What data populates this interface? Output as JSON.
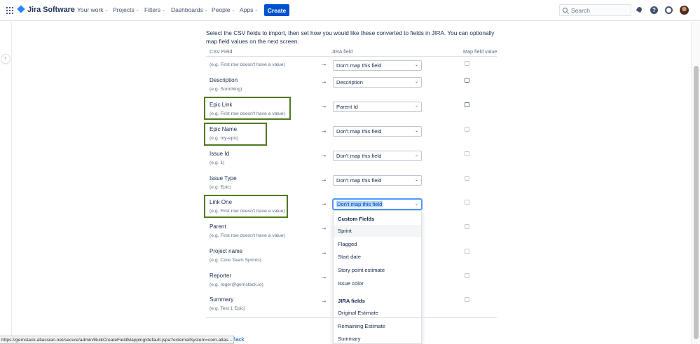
{
  "nav": {
    "logo": "Jira Software",
    "items": [
      {
        "label": "Your work"
      },
      {
        "label": "Projects"
      },
      {
        "label": "Filters"
      },
      {
        "label": "Dashboards"
      },
      {
        "label": "People"
      },
      {
        "label": "Apps"
      }
    ],
    "create_label": "Create",
    "search_placeholder": "Search",
    "help_glyph": "?"
  },
  "sidebar": {
    "toggle_glyph": "›"
  },
  "intro": "Select the CSV fields to import, then set how you would like these converted to fields in JIRA. You can optionally map field values on the next screen.",
  "columns": {
    "csv": "CSV Field",
    "jira": "JIRA field",
    "map": "Map field value"
  },
  "arrow_glyph": "→",
  "rows": [
    {
      "name": "",
      "example": "(e.g. First row doesn't have a value)",
      "jira": "Don't map this field"
    },
    {
      "name": "Description",
      "example": "(e.g. Somthing)",
      "jira": "Description"
    },
    {
      "name": "Epic Link",
      "example": "(e.g. First row doesn't have a value)",
      "jira": "Parent Id"
    },
    {
      "name": "Epic Name",
      "example": "(e.g. my-epic)",
      "jira": "Don't map this field"
    },
    {
      "name": "Issue Id",
      "example": "(e.g. 1)",
      "jira": "Don't map this field"
    },
    {
      "name": "Issue Type",
      "example": "(e.g. Epic)",
      "jira": "Don't map this field"
    },
    {
      "name": "Link One",
      "example": "(e.g. First row doesn't have a value)",
      "jira": "Don't map this field"
    },
    {
      "name": "Parent",
      "example": "(e.g. First row doesn't have a value)",
      "jira": ""
    },
    {
      "name": "Project name",
      "example": "(e.g. Core Team Sprints)",
      "jira": ""
    },
    {
      "name": "Reporter",
      "example": "(e.g. roger@gemstack.io)",
      "jira": ""
    },
    {
      "name": "Summary",
      "example": "(e.g. Test 1 Epic)",
      "jira": ""
    }
  ],
  "dropdown": {
    "group1": "Custom Fields",
    "custom_fields": [
      "Sprint",
      "Flagged",
      "Start date",
      "Story point estimate",
      "Issue color"
    ],
    "group2": "JIRA fields",
    "jira_fields": [
      "Original Estimate",
      "Remaining Estimate",
      "Summary"
    ]
  },
  "footer": {
    "back_label": "Back",
    "status_url": "https://gemstack.atlassian.net/secure/admin/BulkCreateFieldMapping!default.jspa?externalSystem=com.atlas..."
  }
}
